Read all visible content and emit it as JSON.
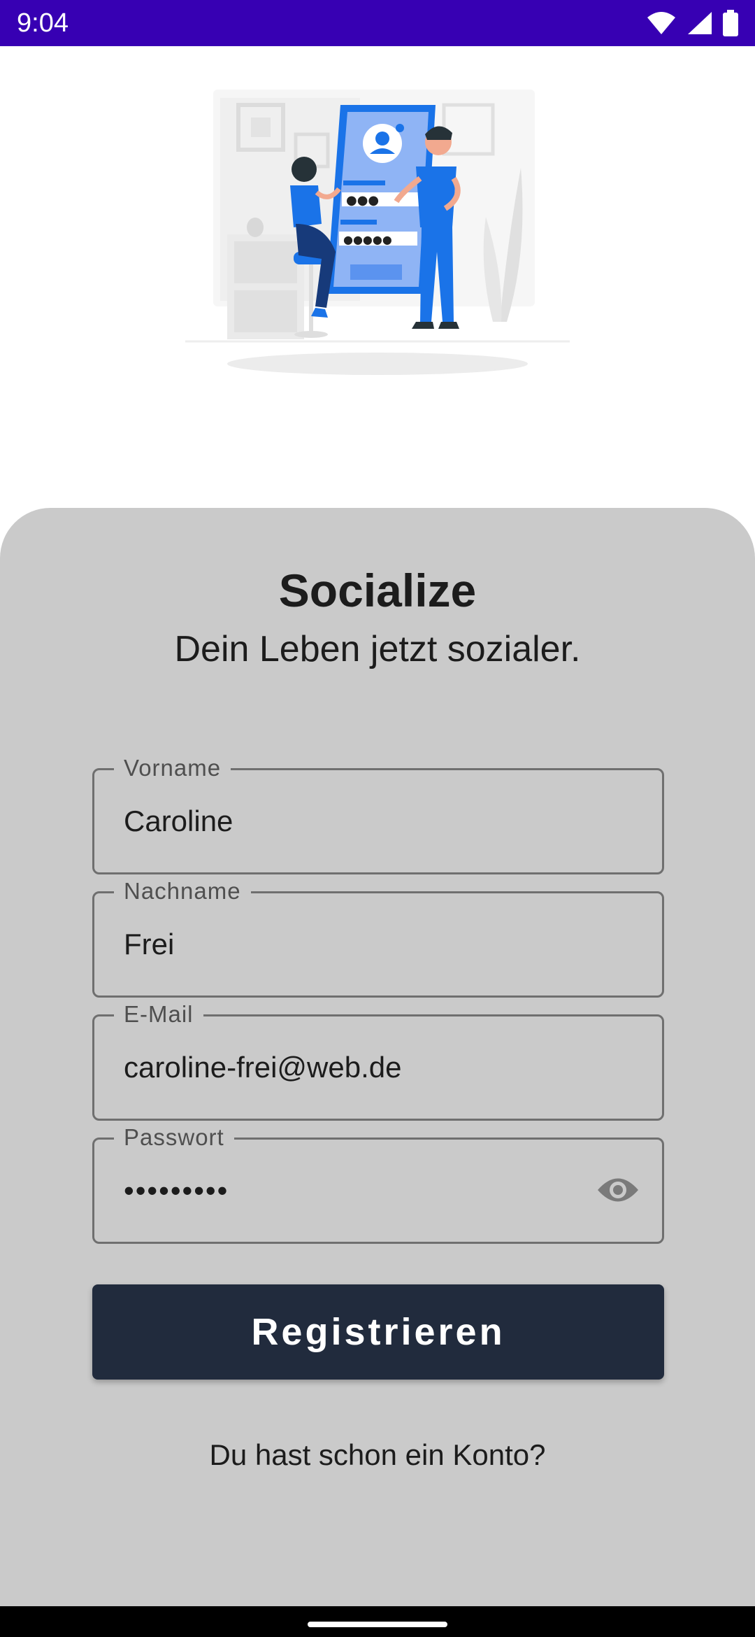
{
  "status_bar": {
    "time": "9:04",
    "icons": [
      "wifi-icon",
      "signal-icon",
      "battery-icon"
    ]
  },
  "app": {
    "title": "Socialize",
    "subtitle": "Dein Leben jetzt sozialer."
  },
  "form": {
    "first_name": {
      "label": "Vorname",
      "value": "Caroline"
    },
    "last_name": {
      "label": "Nachname",
      "value": "Frei"
    },
    "email": {
      "label": "E-Mail",
      "value": "caroline-frei@web.de"
    },
    "password": {
      "label": "Passwort",
      "value": "•••••••••"
    }
  },
  "actions": {
    "register_label": "Registrieren",
    "login_link": "Du hast schon ein Konto?"
  },
  "colors": {
    "status_bar": "#3700b3",
    "sheet": "#cacaca",
    "button": "#212b3d",
    "illustration_blue": "#1a73e8"
  }
}
